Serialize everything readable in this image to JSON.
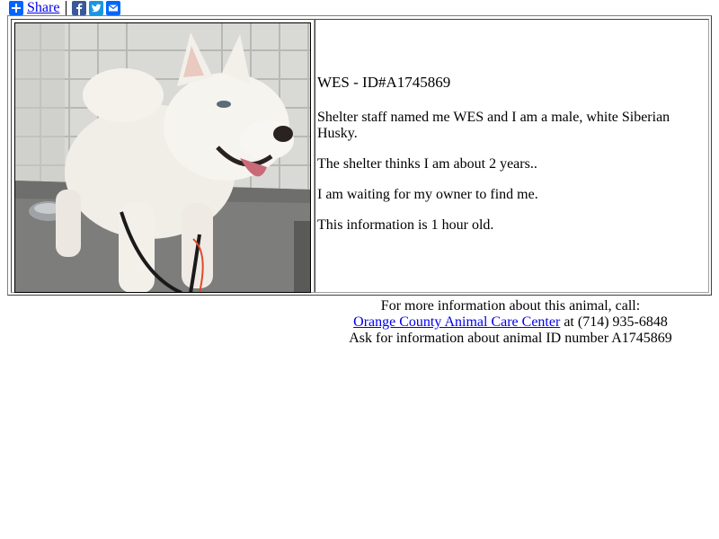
{
  "share": {
    "label": "Share",
    "icons": [
      "plus-icon",
      "facebook-icon",
      "twitter-icon",
      "email-icon"
    ]
  },
  "animal": {
    "title": "WES - ID#A1745869",
    "description_1": "Shelter staff named me WES and I am a male, white Siberian Husky.",
    "description_2": "The shelter thinks I am about 2 years..",
    "description_3": "I am waiting for my owner to find me.",
    "description_4": "This information is 1 hour old.",
    "photo_alt": "white Siberian Husky dog"
  },
  "contact": {
    "intro": "For more information about this animal, call:",
    "shelter_name": "Orange County Animal Care Center",
    "phone_text": " at (714) 935-6848",
    "ask_text": "Ask for information about animal ID number A1745869"
  },
  "colors": {
    "link": "#0000ee",
    "share_blue": "#0166ff",
    "facebook": "#3b5998",
    "twitter": "#1b95e0"
  }
}
